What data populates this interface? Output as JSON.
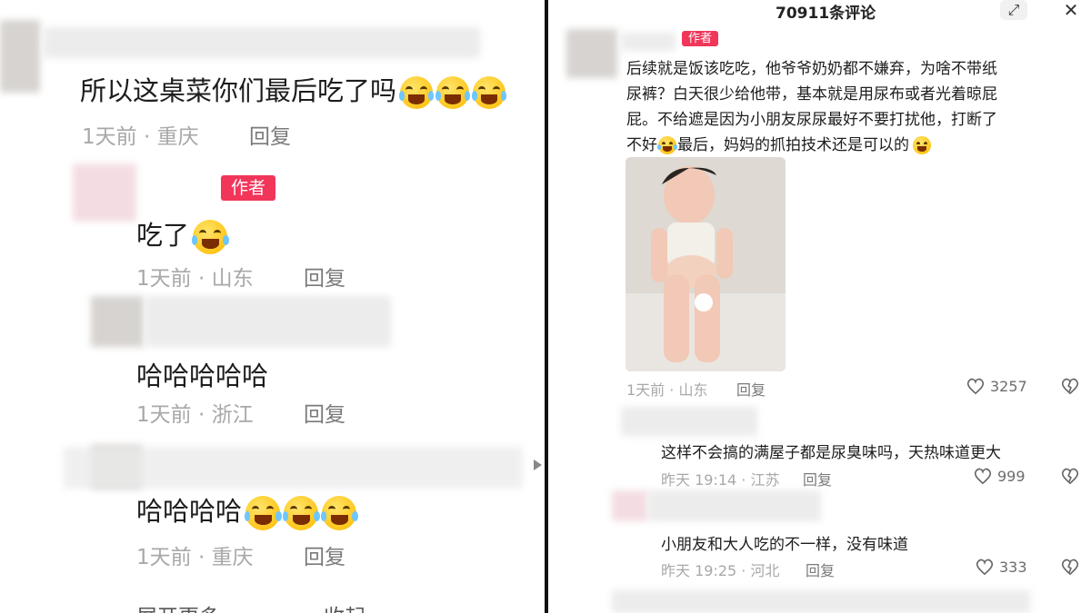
{
  "left": {
    "comments": [
      {
        "text": "所以这桌菜你们最后吃了吗",
        "emojis": 3,
        "time": "1天前",
        "location": "重庆",
        "reply": "回复"
      },
      {
        "author_tag": "作者",
        "text": "吃了",
        "emojis": 1,
        "time": "1天前",
        "location": "山东",
        "reply": "回复"
      },
      {
        "text": "哈哈哈哈哈",
        "emojis": 0,
        "time": "1天前",
        "location": "浙江",
        "reply": "回复"
      },
      {
        "text": "哈哈哈哈",
        "emojis": 3,
        "time": "1天前",
        "location": "重庆",
        "reply": "回复"
      }
    ],
    "footer": {
      "expand": "展开更多",
      "collapse": "收起"
    }
  },
  "right": {
    "header": {
      "title": "70911条评论",
      "expand_icon": "expand-icon",
      "close_icon": "close-icon"
    },
    "main_comment": {
      "author_tag": "作者",
      "line1": "后续就是饭该吃吃，他爷爷奶奶都不嫌弃，为啥不带纸",
      "line2": "尿裤？白天很少给他带，基本就是用尿布或者光着晾屁",
      "line3": "屁。不给遮是因为小朋友尿尿最好不要打扰他，打断了",
      "line4a": "不好",
      "line4b": "最后，妈妈的抓拍技术还是可以的",
      "time": "1天前 · 山东",
      "reply": "回复",
      "likes": "3257"
    },
    "replies": [
      {
        "text": "这样不会搞的满屋子都是尿臭味吗，天热味道更大",
        "time": "昨天 19:14 · 江苏",
        "reply": "回复",
        "likes": "999"
      },
      {
        "text": "小朋友和大人吃的不一样，没有味道",
        "time": "昨天 19:25 · 河北",
        "reply": "回复",
        "likes": "333"
      }
    ]
  },
  "colors": {
    "author_tag": "#f1365a",
    "divider": "#111111",
    "meta": "#a8a8a8"
  }
}
